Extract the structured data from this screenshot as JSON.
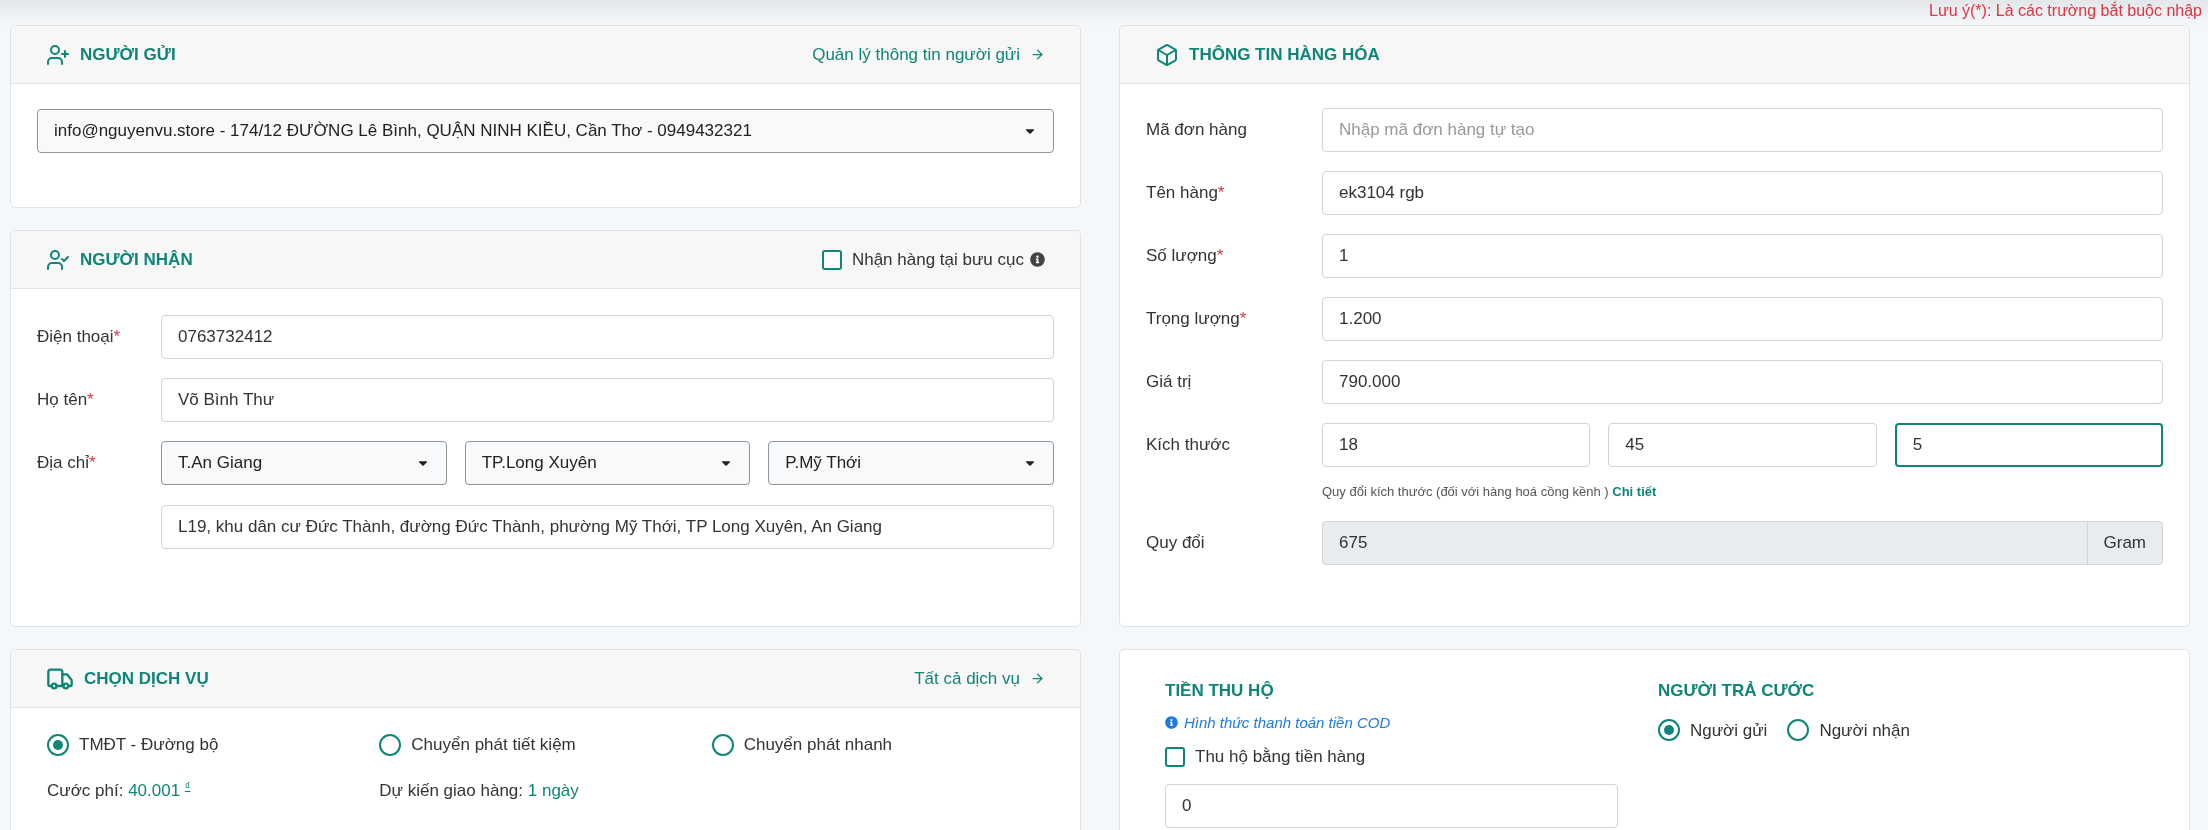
{
  "note": {
    "text": "Lưu ý(*): Là các trường bắt buộc nhập"
  },
  "sender": {
    "title": "NGƯỜI GỬI",
    "link": "Quản lý thông tin người gửi",
    "selected_sender": "info@nguyenvu.store - 174/12 ĐƯỜNG Lê Bình, QUẬN NINH KIỀU, Cần Thơ - 0949432321"
  },
  "receiver": {
    "title": "NGƯỜI NHẬN",
    "pickup_checkbox": {
      "label": "Nhận hàng tại bưu cục",
      "checked": false
    },
    "fields": [
      {
        "label": "Điện thoại",
        "required_mark": "*",
        "value": "0763732412"
      },
      {
        "label": "Họ tên",
        "required_mark": "*",
        "value": "Võ Bình Thư"
      }
    ],
    "address": {
      "label": "Địa chỉ",
      "required_mark": "*",
      "province": "T.An Giang",
      "district": "TP.Long Xuyên",
      "ward": "P.Mỹ Thới",
      "street": "L19, khu dân cư Đức Thành, đường Đức Thành, phường Mỹ Thới, TP Long Xuyên, An Giang"
    }
  },
  "service": {
    "title": "CHỌN DỊCH VỤ",
    "link": "Tất cả dịch vụ",
    "options": [
      {
        "label": "TMĐT - Đường bộ",
        "selected": true
      },
      {
        "label": "Chuyển phát tiết kiệm",
        "selected": false
      },
      {
        "label": "Chuyển phát nhanh",
        "selected": false
      }
    ],
    "fee_label": "Cước phí:",
    "fee_value": "40.001",
    "currency": "₫",
    "delivery_label": "Dự kiến giao hàng:",
    "delivery_value": "1 ngày"
  },
  "goods": {
    "title": "THÔNG TIN HÀNG HÓA",
    "fields": [
      {
        "label": "Mã đơn hàng",
        "placeholder": "Nhập mã đơn hàng tự tạo"
      },
      {
        "label": "Tên hàng",
        "required_mark": "*",
        "value": "ek3104 rgb"
      },
      {
        "label": "Số lượng",
        "required_mark": "*",
        "value": "1"
      },
      {
        "label": "Trọng lượng",
        "required_mark": "*",
        "value": "1.200"
      },
      {
        "label": "Giá trị",
        "value": "790.000"
      }
    ],
    "dimensions": {
      "label": "Kích thước",
      "values": [
        {
          "value": "18",
          "focused": false
        },
        {
          "value": "45",
          "focused": false
        },
        {
          "value": "5",
          "focused": true
        }
      ]
    },
    "hint": "Quy đổi kích thước (đối với hàng hoá cồng kềnh )",
    "hint_link": "Chi tiết",
    "conversion": {
      "label": "Quy đổi",
      "value": "675",
      "unit": "Gram"
    }
  },
  "cod": {
    "title": "TIỀN THU HỘ",
    "hint": "Hình thức thanh toán tiền COD",
    "checkbox": {
      "label": "Thu hộ bằng tiền hàng",
      "checked": false
    },
    "amount": "0"
  },
  "payer": {
    "title": "NGƯỜI TRẢ CƯỚC",
    "options": [
      {
        "label": "Người gửi",
        "selected": true
      },
      {
        "label": "Người nhận",
        "selected": false
      }
    ]
  }
}
